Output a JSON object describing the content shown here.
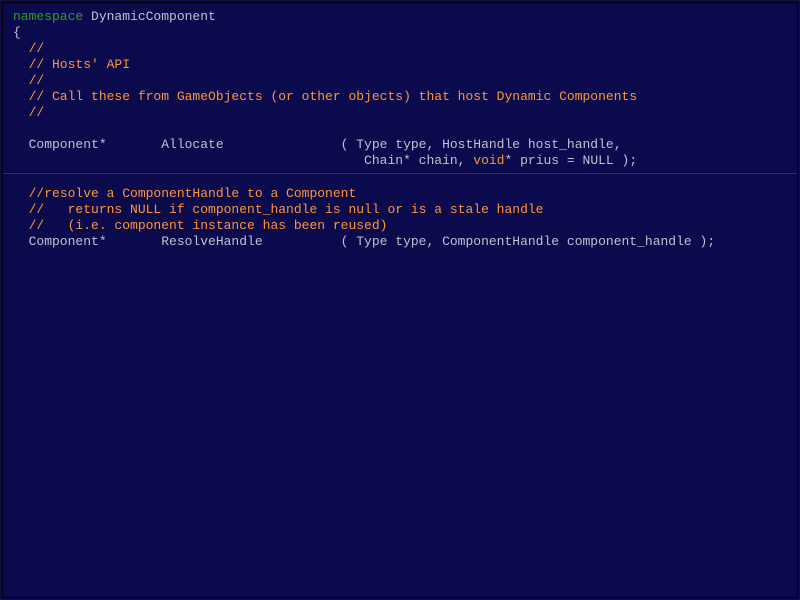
{
  "code": {
    "ns_kw": "namespace",
    "ns_name": " DynamicComponent",
    "brace_open": "{",
    "c1": "  //",
    "c2": "  // Hosts' API",
    "c3": "  //",
    "c4": "  // Call these from GameObjects (or other objects) that host Dynamic Components",
    "c5": "  //",
    "sig1a": "  Component*       Allocate               ( Type type, HostHandle host_handle,",
    "sig1b_pre": "                                             Chain* chain, ",
    "sig1b_void": "void",
    "sig1b_post": "* prius = NULL );",
    "c6": "  //resolve a ComponentHandle to a Component",
    "c7": "  //   returns NULL if component_handle is null or is a stale handle",
    "c8": "  //   (i.e. component instance has been reused)",
    "sig2": "  Component*       ResolveHandle          ( Type type, ComponentHandle component_handle );"
  }
}
